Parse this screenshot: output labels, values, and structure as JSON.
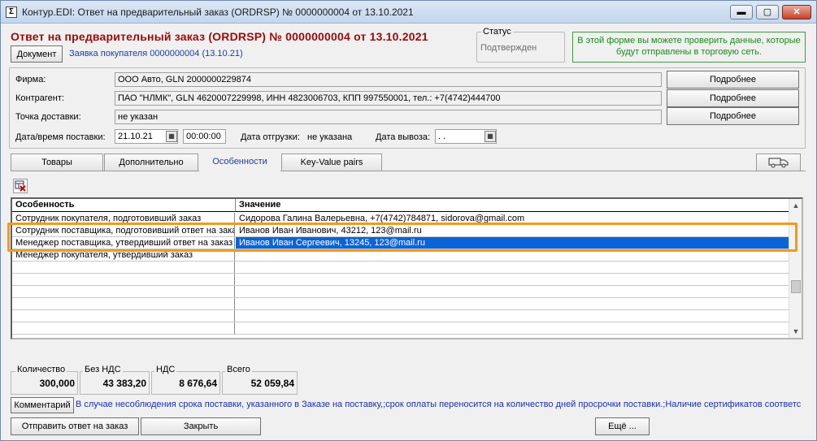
{
  "window": {
    "title": "Контур.EDI: Ответ на предварительный заказ (ORDRSP) № 0000000004 от 13.10.2021",
    "controls": {
      "minimize": "▬",
      "maximize": "▢",
      "close": "✕"
    }
  },
  "header": {
    "heading": "Ответ на предварительный заказ (ORDRSP) № 0000000004 от 13.10.2021",
    "document_button": "Документ",
    "buyer_order_link": "Заявка покупателя 0000000004 (13.10.21)",
    "status_label": "Статус",
    "status_value": "Подтвержден",
    "info_text": "В этой форме вы можете проверить данные, которые будут отправлены в торговую сеть."
  },
  "form": {
    "firm_label": "Фирма:",
    "firm_value": "ООО Авто, GLN 2000000229874",
    "counterparty_label": "Контрагент:",
    "counterparty_value": "ПАО \"НЛМК\", GLN 4620007229998, ИНН 4823006703, КПП 997550001, тел.: +7(4742)444700",
    "delivery_point_label": "Точка доставки:",
    "delivery_point_value": "не указан",
    "details_button": "Подробнее",
    "delivery_datetime_label": "Дата/время поставки:",
    "delivery_date": "21.10.21",
    "delivery_time": "00:00:00",
    "shipment_date_label": "Дата отгрузки:",
    "shipment_date_value": "не указана",
    "pickup_date_label": "Дата вывоза:",
    "pickup_date_value": " .  ."
  },
  "tabs": [
    {
      "label": "Товары"
    },
    {
      "label": "Дополнительно"
    },
    {
      "label": "Особенности"
    },
    {
      "label": "Key-Value pairs"
    }
  ],
  "grid": {
    "columns": [
      "Особенность",
      "Значение"
    ],
    "rows": [
      {
        "feature": "Сотрудник покупателя, подготовивший заказ",
        "value": "Сидорова Галина Валерьевна, +7(4742)784871, sidorova@gmail.com"
      },
      {
        "feature": "Сотрудник поставщика, подготовивший ответ на заказ",
        "value": "Иванов Иван Иванович, 43212, 123@mail.ru"
      },
      {
        "feature": "Менеджер поставщика, утвердивший ответ на заказ",
        "value": "Иванов Иван Сергеевич, 13245, 123@mail.ru"
      },
      {
        "feature": "Менеджер покупателя, утвердивший заказ",
        "value": ""
      }
    ]
  },
  "totals": {
    "quantity_label": "Количество",
    "quantity_value": "300,000",
    "without_vat_label": "Без НДС",
    "without_vat_value": "43 383,20",
    "vat_label": "НДС",
    "vat_value": "8 676,64",
    "total_label": "Всего",
    "total_value": "52 059,84"
  },
  "comment": {
    "button": "Комментарий",
    "text": "В случае несоблюдения срока поставки, указанного в Заказе на поставку,;срок оплаты переносится на количество дней просрочки поставки.;Наличие сертификатов соответс"
  },
  "footer": {
    "send_button": "Отправить ответ на заказ",
    "close_button": "Закрыть",
    "more_button": "Ещё ..."
  }
}
